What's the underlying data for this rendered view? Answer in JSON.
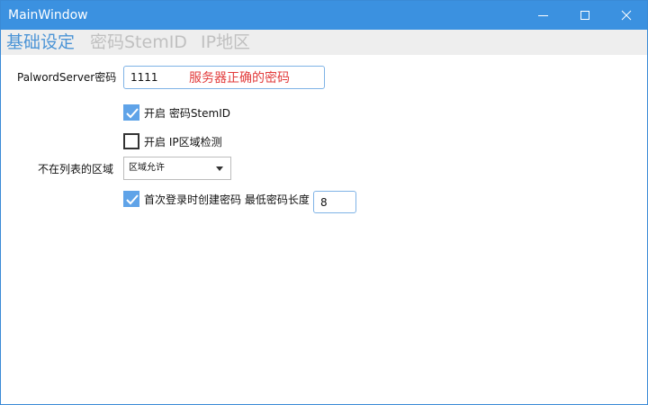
{
  "window": {
    "title": "MainWindow",
    "icons": {
      "minimize": "minimize-icon",
      "maximize": "maximize-icon",
      "close": "close-icon"
    }
  },
  "tabs": [
    {
      "label": "基础设定",
      "active": true
    },
    {
      "label": "密码StemID",
      "active": false
    },
    {
      "label": "IP地区",
      "active": false
    }
  ],
  "form": {
    "password_label": "PalwordServer密码",
    "password_value": "1111",
    "password_hint": "服务器正确的密码",
    "enable_stemid": {
      "label": "开启 密码StemID",
      "checked": true
    },
    "enable_ip_detect": {
      "label": "开启 IP区域检测",
      "checked": false
    },
    "region_label": "不在列表的区域",
    "region_select": {
      "value": "区域允许"
    },
    "first_login": {
      "label": "首次登录时创建密码 最低密码长度",
      "checked": true
    },
    "min_length_value": "8"
  },
  "colors": {
    "titlebar": "#3b91e0",
    "accent": "#5fa3e8",
    "active_tab": "#4b94d6",
    "inactive_tab": "#c0c0c0",
    "hint_red": "#e23b3b"
  }
}
